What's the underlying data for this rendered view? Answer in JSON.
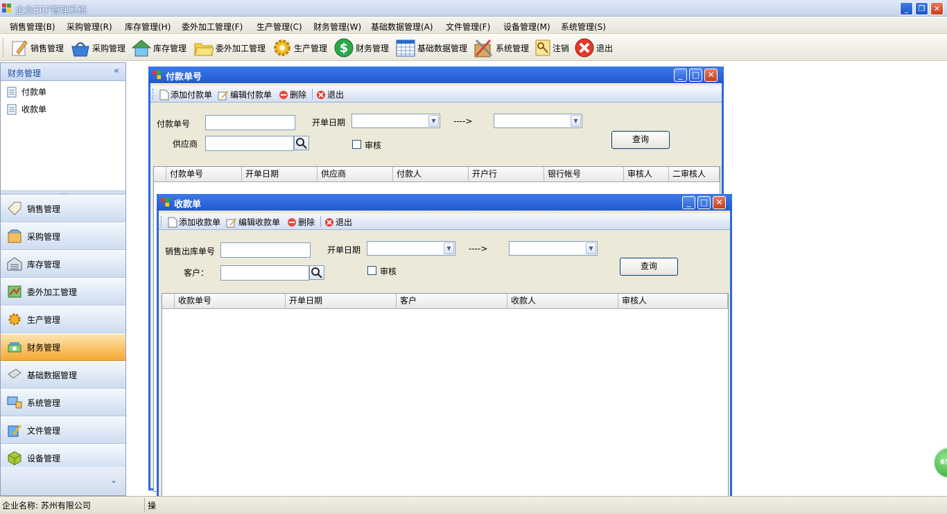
{
  "app": {
    "title": "企业ERP管理系统"
  },
  "menu": [
    "销售管理(B)",
    "采购管理(R)",
    "库存管理(H)",
    "委外加工管理(F)",
    "生产管理(C)",
    "财务管理(W)",
    "基础数据管理(A)",
    "文件管理(F)",
    "设备管理(M)",
    "系统管理(S)"
  ],
  "toolbar": [
    "销售管理",
    "采购管理",
    "库存管理",
    "委外加工管理",
    "生产管理",
    "财务管理",
    "基础数据管理",
    "系统管理",
    "注销",
    "退出"
  ],
  "left_panel": {
    "header": "财务管理",
    "collapse": "«",
    "items": [
      "付款单",
      "收款单"
    ],
    "splitter": "....",
    "nav": [
      "销售管理",
      "采购管理",
      "库存管理",
      "委外加工管理",
      "生产管理",
      "财务管理",
      "基础数据管理",
      "系统管理",
      "文件管理",
      "设备管理"
    ],
    "active_nav": "财务管理",
    "expand": "⌄"
  },
  "payment_window": {
    "title": "付款单号",
    "toolbar": [
      "添加付款单",
      "编辑付款单",
      "删除",
      "退出"
    ],
    "labels": {
      "number": "付款单号",
      "date": "开单日期",
      "arrow": "---->",
      "supplier": "供应商",
      "audit": "审核"
    },
    "query_button": "查询",
    "columns": [
      "付款单号",
      "开单日期",
      "供应商",
      "付款人",
      "开户行",
      "银行帐号",
      "审核人",
      "二审核人"
    ]
  },
  "receipt_window": {
    "title": "收款单",
    "toolbar": [
      "添加收款单",
      "编辑收款单",
      "删除",
      "退出"
    ],
    "labels": {
      "number": "销售出库单号",
      "date": "开单日期",
      "arrow": "---->",
      "customer": "客户：",
      "audit": "审核"
    },
    "query_button": "查询",
    "columns": [
      "收款单号",
      "开单日期",
      "客户",
      "收款人",
      "审核人"
    ]
  },
  "status": {
    "company": "企业名称: 苏州有限公司",
    "operator": "操"
  },
  "badge": "65"
}
